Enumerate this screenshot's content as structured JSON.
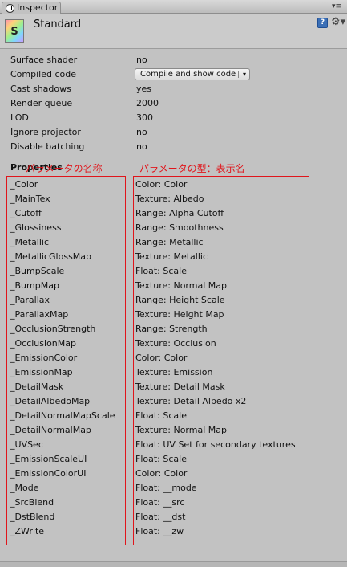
{
  "tab": {
    "label": "Inspector",
    "menu_glyph": "▾≡"
  },
  "header": {
    "shader_name": "Standard",
    "icon_letter": "S",
    "help_glyph": "?",
    "gear_glyph": "⚙▾"
  },
  "info": [
    {
      "label": "Surface shader",
      "value": "no"
    },
    {
      "label": "Compiled code",
      "value": "Compile and show code",
      "type": "dropdown",
      "arrow": "▾"
    },
    {
      "label": "Cast shadows",
      "value": "yes"
    },
    {
      "label": "Render queue",
      "value": "2000"
    },
    {
      "label": "LOD",
      "value": "300"
    },
    {
      "label": "Ignore projector",
      "value": "no"
    },
    {
      "label": "Disable batching",
      "value": "no"
    }
  ],
  "properties_heading": "Properties",
  "annotations": {
    "left": "パラメータの名称",
    "right": "パラメータの型：表示名",
    "color": "#e0151b"
  },
  "properties": [
    {
      "name": "_Color",
      "type": "Color: Color"
    },
    {
      "name": "_MainTex",
      "type": "Texture: Albedo"
    },
    {
      "name": "_Cutoff",
      "type": "Range: Alpha Cutoff"
    },
    {
      "name": "_Glossiness",
      "type": "Range: Smoothness"
    },
    {
      "name": "_Metallic",
      "type": "Range: Metallic"
    },
    {
      "name": "_MetallicGlossMap",
      "type": "Texture: Metallic"
    },
    {
      "name": "_BumpScale",
      "type": "Float: Scale"
    },
    {
      "name": "_BumpMap",
      "type": "Texture: Normal Map"
    },
    {
      "name": "_Parallax",
      "type": "Range: Height Scale"
    },
    {
      "name": "_ParallaxMap",
      "type": "Texture: Height Map"
    },
    {
      "name": "_OcclusionStrength",
      "type": "Range: Strength"
    },
    {
      "name": "_OcclusionMap",
      "type": "Texture: Occlusion"
    },
    {
      "name": "_EmissionColor",
      "type": "Color: Color"
    },
    {
      "name": "_EmissionMap",
      "type": "Texture: Emission"
    },
    {
      "name": "_DetailMask",
      "type": "Texture: Detail Mask"
    },
    {
      "name": "_DetailAlbedoMap",
      "type": "Texture: Detail Albedo x2"
    },
    {
      "name": "_DetailNormalMapScale",
      "type": "Float: Scale"
    },
    {
      "name": "_DetailNormalMap",
      "type": "Texture: Normal Map"
    },
    {
      "name": "_UVSec",
      "type": "Float: UV Set for secondary textures"
    },
    {
      "name": "_EmissionScaleUI",
      "type": "Float: Scale"
    },
    {
      "name": "_EmissionColorUI",
      "type": "Color: Color"
    },
    {
      "name": "_Mode",
      "type": "Float: __mode"
    },
    {
      "name": "_SrcBlend",
      "type": "Float: __src"
    },
    {
      "name": "_DstBlend",
      "type": "Float: __dst"
    },
    {
      "name": "_ZWrite",
      "type": "Float: __zw"
    }
  ]
}
